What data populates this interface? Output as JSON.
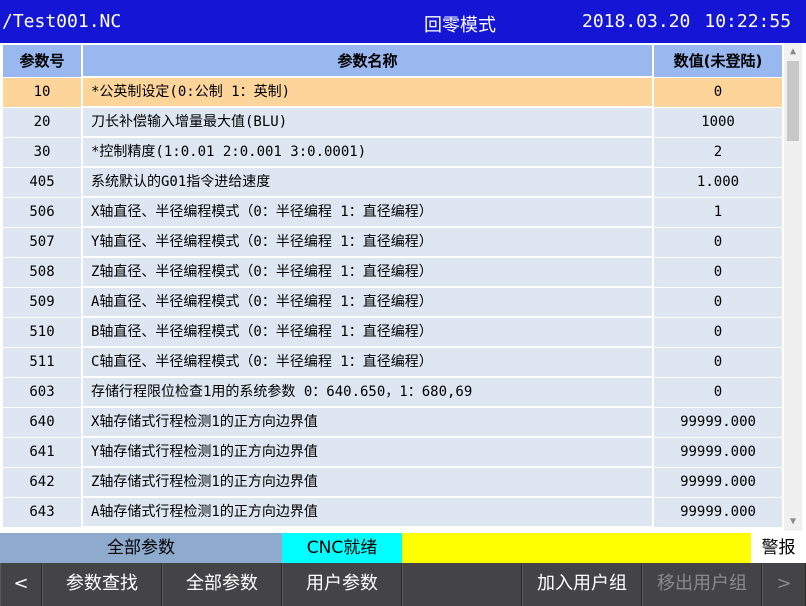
{
  "title_bar": {
    "file": "/Test001.NC",
    "mode": "回零模式",
    "date": "2018.03.20",
    "time": "10:22:55"
  },
  "table": {
    "headers": {
      "no": "参数号",
      "name": "参数名称",
      "value": "数值(未登陆)"
    },
    "selected_row": 0,
    "rows": [
      {
        "no": "10",
        "name": "*公英制设定(0:公制 1：英制)",
        "value": "0"
      },
      {
        "no": "20",
        "name": "刀长补偿输入增量最大值(BLU)",
        "value": "1000"
      },
      {
        "no": "30",
        "name": "*控制精度(1:0.01 2:0.001 3:0.0001)",
        "value": "2"
      },
      {
        "no": "405",
        "name": "系统默认的G01指令进给速度",
        "value": "1.000"
      },
      {
        "no": "506",
        "name": "X轴直径、半径编程模式（0：半径编程 1：直径编程）",
        "value": "1"
      },
      {
        "no": "507",
        "name": "Y轴直径、半径编程模式（0：半径编程 1：直径编程）",
        "value": "0"
      },
      {
        "no": "508",
        "name": "Z轴直径、半径编程模式（0：半径编程 1：直径编程）",
        "value": "0"
      },
      {
        "no": "509",
        "name": "A轴直径、半径编程模式（0：半径编程 1：直径编程）",
        "value": "0"
      },
      {
        "no": "510",
        "name": "B轴直径、半径编程模式（0：半径编程 1：直径编程）",
        "value": "0"
      },
      {
        "no": "511",
        "name": "C轴直径、半径编程模式（0：半径编程 1：直径编程）",
        "value": "0"
      },
      {
        "no": "603",
        "name": "存储行程限位检查1用的系统参数 0：640.650，1：680,69",
        "value": "0"
      },
      {
        "no": "640",
        "name": "X轴存储式行程检测1的正方向边界值",
        "value": "99999.000"
      },
      {
        "no": "641",
        "name": "Y轴存储式行程检测1的正方向边界值",
        "value": "99999.000"
      },
      {
        "no": "642",
        "name": "Z轴存储式行程检测1的正方向边界值",
        "value": "99999.000"
      },
      {
        "no": "643",
        "name": "A轴存储式行程检测1的正方向边界值",
        "value": "99999.000"
      }
    ]
  },
  "status_bar": {
    "param_group": "全部参数",
    "cnc_status": "CNC就绪",
    "message": "",
    "alarm": "警报",
    "colors": {
      "param_group": "#8eaacd",
      "cnc_status": "#00ffff",
      "message": "#ffff00"
    }
  },
  "softkeys": {
    "prev": "<",
    "next": ">",
    "keys": [
      "参数查找",
      "全部参数",
      "用户参数",
      "",
      "加入用户组",
      "移出用户组"
    ]
  },
  "colors": {
    "title_bar": "#1515d6",
    "header": "#99b8f0",
    "row": "#dde6f1",
    "selected_row": "#fdd49a",
    "softkey_bg": "#444446"
  },
  "icons": {
    "scroll_up": "triangle-up-icon",
    "scroll_down": "triangle-down-icon"
  }
}
